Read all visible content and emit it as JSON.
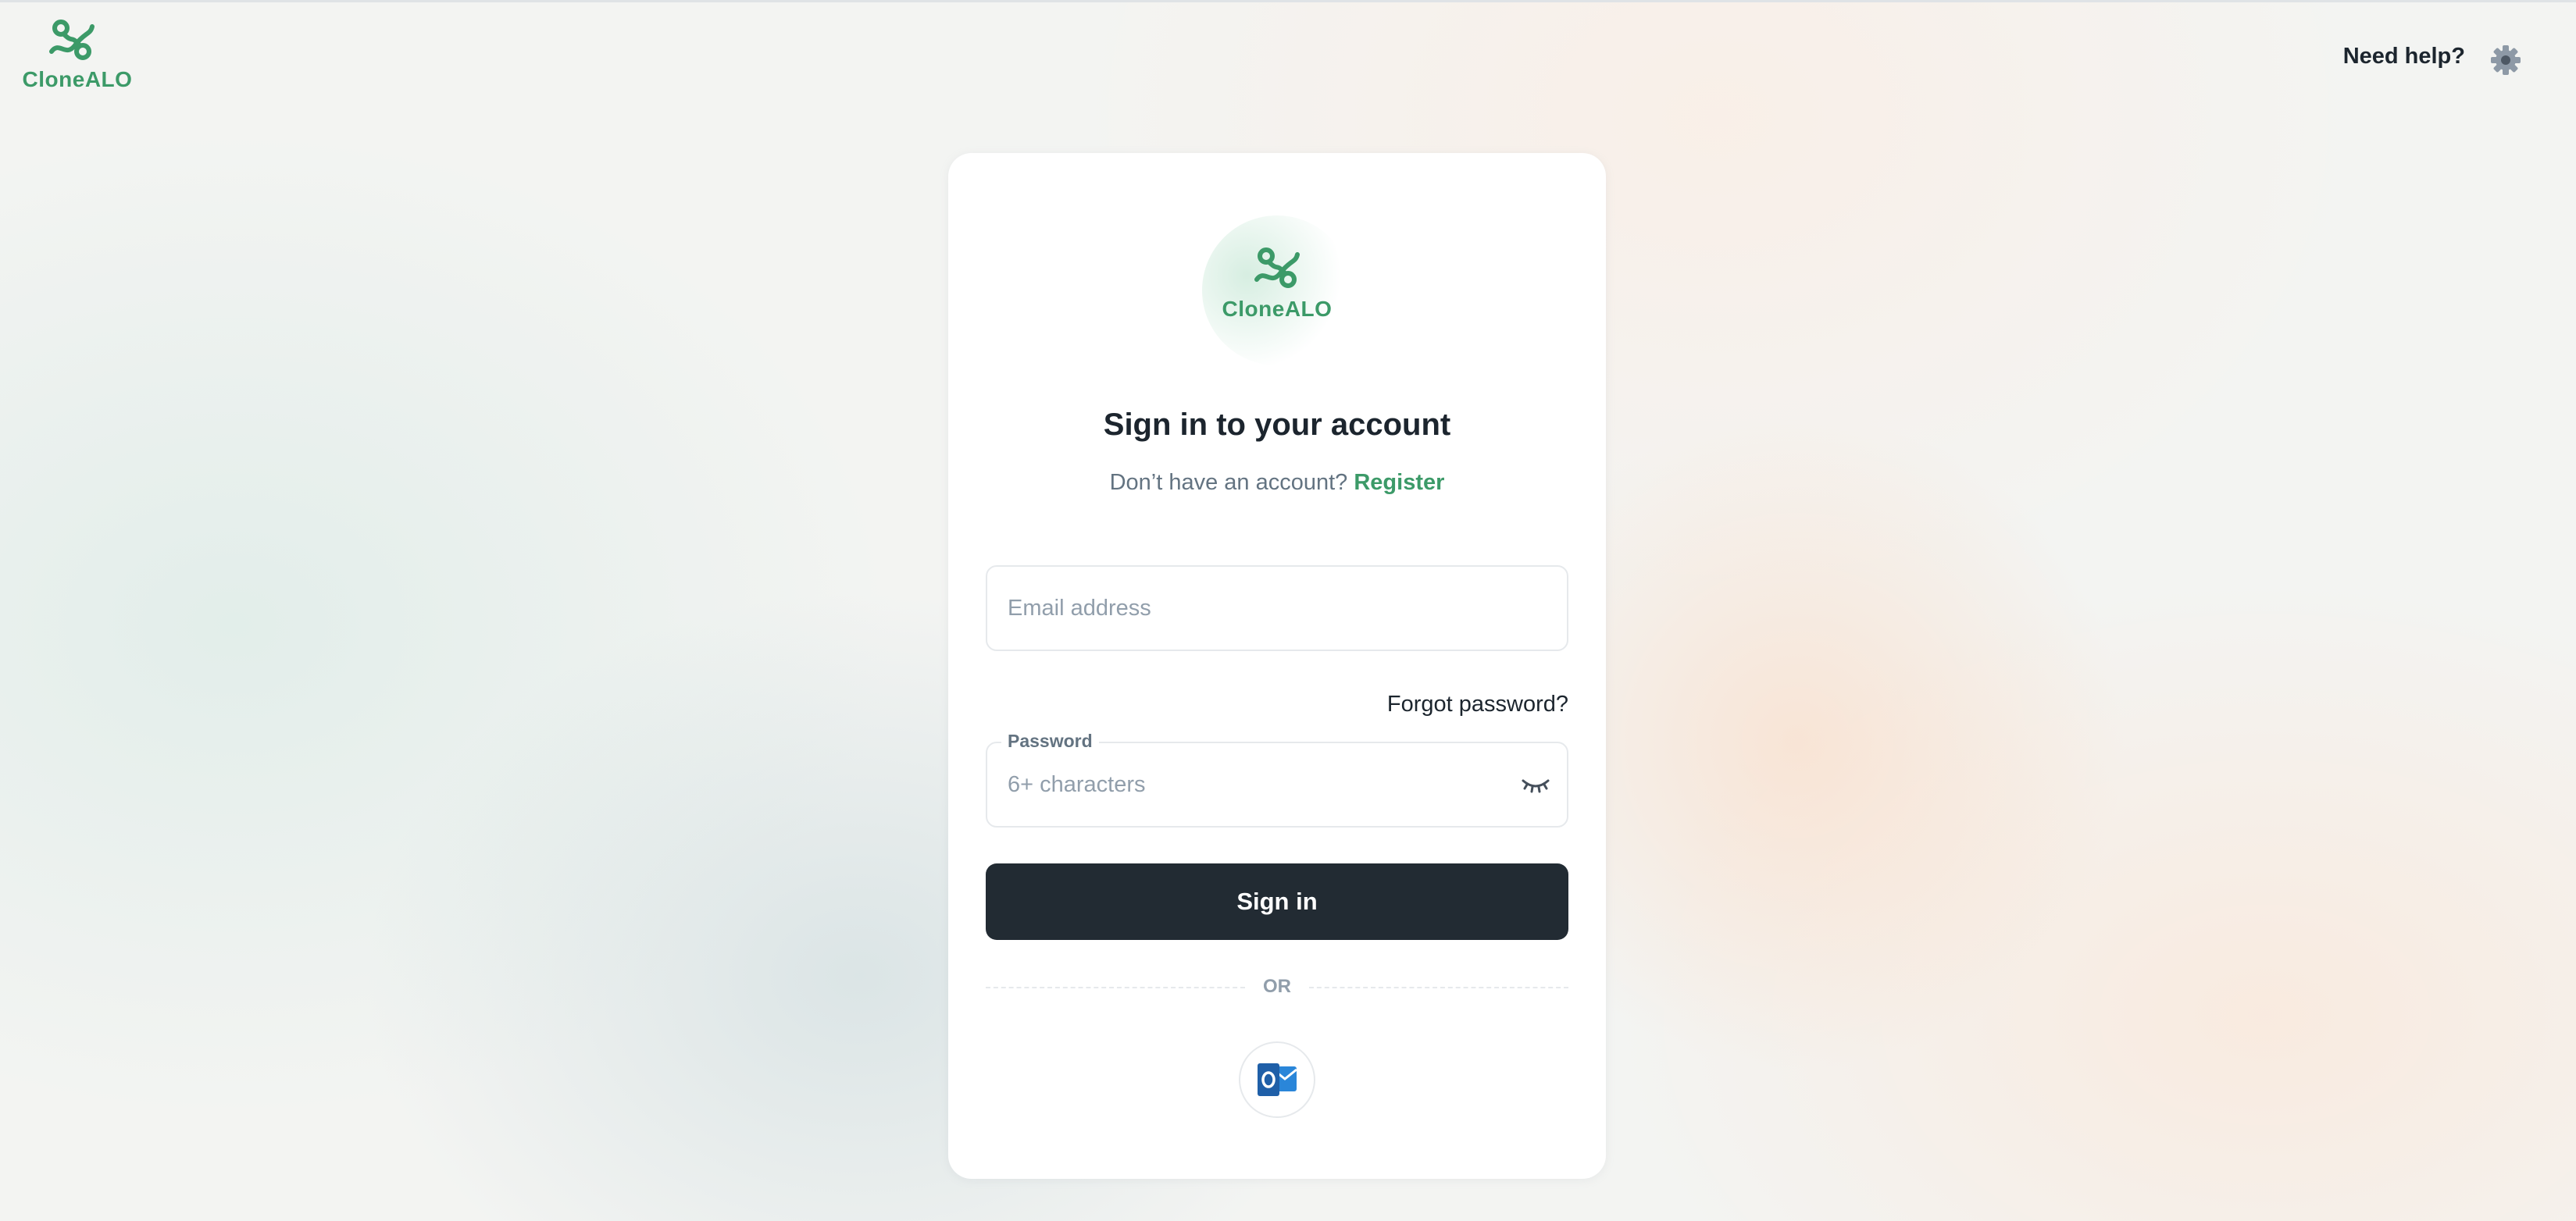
{
  "header": {
    "brand_name": "CloneALO",
    "help_label": "Need help?",
    "settings_icon": "gear-icon"
  },
  "card": {
    "logo_name": "CloneALO",
    "title": "Sign in to your account",
    "subtitle_prefix": "Don’t have an account?",
    "register_label": "Register",
    "email": {
      "value": "",
      "placeholder": "Email address"
    },
    "forgot_label": "Forgot password?",
    "password": {
      "label": "Password",
      "value": "",
      "placeholder": "6+ characters",
      "toggle_icon": "eye-closed-icon"
    },
    "signin_label": "Sign in",
    "divider_label": "OR",
    "oauth_icon": "outlook-icon"
  },
  "colors": {
    "brand_green": "#3c9a68",
    "button_dark": "#222b33",
    "outlook_blue": "#1f6fc5"
  }
}
